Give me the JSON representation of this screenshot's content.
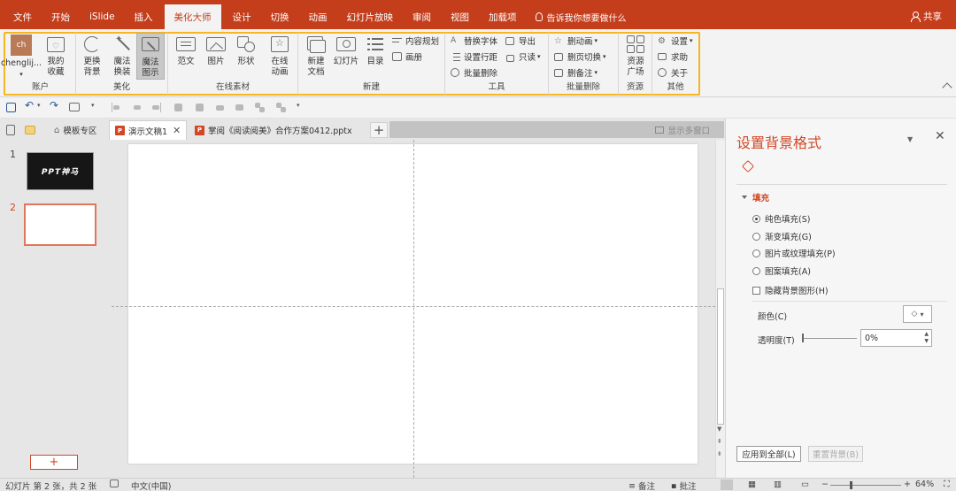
{
  "menu": {
    "items": [
      "文件",
      "开始",
      "iSlide",
      "插入",
      "美化大师",
      "设计",
      "切换",
      "动画",
      "幻灯片放映",
      "审阅",
      "视图",
      "加载项"
    ],
    "active_index": 4,
    "tell_me": "告诉我你想要做什么",
    "share": "共享"
  },
  "ribbon": {
    "account": {
      "avatar_text": "ch",
      "user": "chenglij...",
      "favorites": "我的收藏",
      "label": "账户"
    },
    "beautify": {
      "change_bg_1": "更换",
      "change_bg_2": "背景",
      "magic_swap_1": "魔法",
      "magic_swap_2": "换装",
      "magic_diagram_1": "魔法",
      "magic_diagram_2": "图示",
      "label": "美化"
    },
    "online": {
      "sample": "范文",
      "picture": "图片",
      "shape": "形状",
      "anim_1": "在线",
      "anim_2": "动画",
      "label": "在线素材"
    },
    "new": {
      "newdoc_1": "新建",
      "newdoc_2": "文档",
      "slide": "幻灯片",
      "toc": "目录",
      "content_plan": "内容规划",
      "album": "画册",
      "label": "新建"
    },
    "tools": {
      "replace_font": "替换字体",
      "line_spacing": "设置行距",
      "batch_delete": "批量删除",
      "export": "导出",
      "read_only": "只读",
      "label": "工具"
    },
    "batch": {
      "del_anim": "删动画",
      "del_transition": "删页切换",
      "del_notes": "删备注",
      "label": "批量删除"
    },
    "resource": {
      "square_1": "资源",
      "square_2": "广场",
      "label": "资源"
    },
    "other": {
      "settings": "设置",
      "help": "求助",
      "about": "关于",
      "label": "其他"
    }
  },
  "tabs": {
    "template_zone": "模板专区",
    "doc1": "演示文稿1",
    "doc2": "掌阅《阅读阅美》合作方案0412.pptx",
    "multi_window": "显示多窗口"
  },
  "slides": {
    "thumb_numbers": [
      "1",
      "2"
    ],
    "thumb1_text": "PPT神马",
    "selected": 2,
    "add": "+"
  },
  "pane": {
    "title": "设置背景格式",
    "section": "填充",
    "options": [
      "纯色填充(S)",
      "渐变填充(G)",
      "图片或纹理填充(P)",
      "图案填充(A)"
    ],
    "selected_option": 0,
    "hide_bg": "隐藏背景图形(H)",
    "color_label": "颜色(C)",
    "transparency_label": "透明度(T)",
    "transparency_value": "0%",
    "apply_all": "应用到全部(L)",
    "reset_bg": "重置背景(B)"
  },
  "status": {
    "slide_info": "幻灯片 第 2 张，共 2 张",
    "language": "中文(中国)",
    "notes": "备注",
    "comments": "批注",
    "zoom": "64%"
  },
  "colors": {
    "brand": "#c43e1c",
    "accent": "#d24726",
    "highlight": "#f4b720"
  }
}
